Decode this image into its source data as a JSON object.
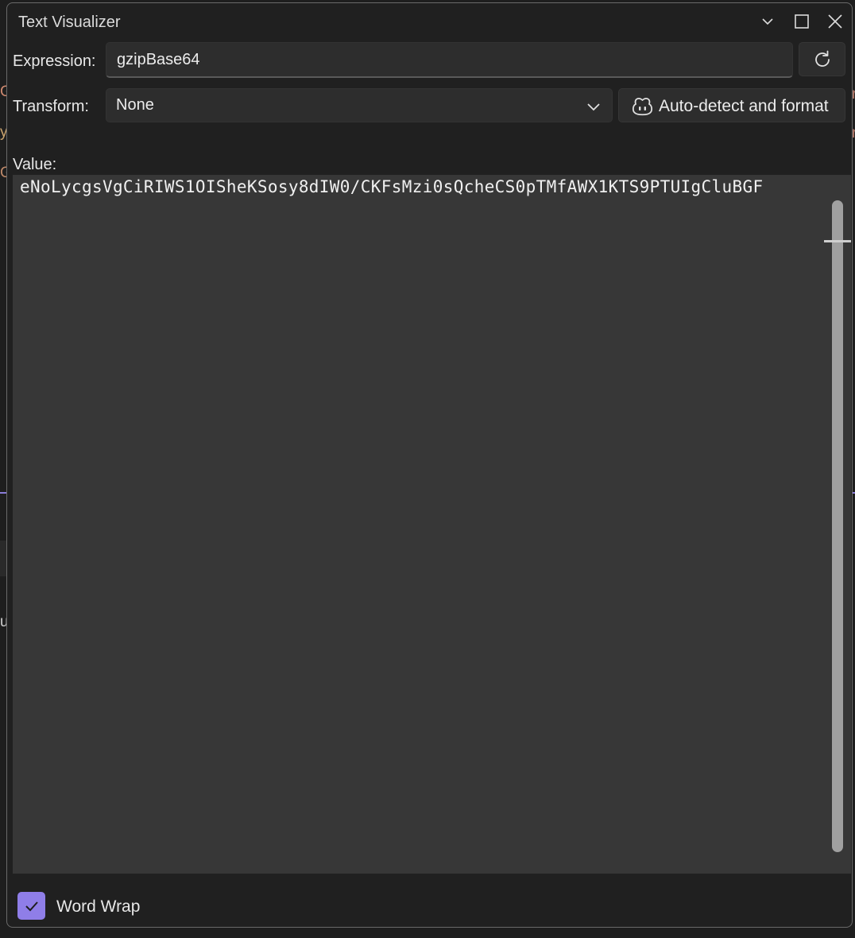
{
  "window": {
    "title": "Text Visualizer"
  },
  "titlebar_buttons": {
    "collapse_icon": "chevron-down-icon",
    "maximize_icon": "maximize-icon",
    "close_icon": "close-icon"
  },
  "expression": {
    "label": "Expression:",
    "value": "gzipBase64",
    "refresh_icon": "refresh-icon"
  },
  "transform": {
    "label": "Transform:",
    "selected": "None",
    "auto_button_label": "Auto-detect and format",
    "auto_button_icon": "copilot-icon"
  },
  "value": {
    "label": "Value:",
    "text": "eNoLycgsVgCiRIWS1OISheKSosy8dIW0/CKFsMzi0sQcheCS0pTMfAWX1KTS9PTUIgCluBGF"
  },
  "word_wrap": {
    "label": "Word Wrap",
    "checked": true
  },
  "colors": {
    "accent": "#8f7ee8",
    "window_bg": "#202020",
    "field_bg": "#2d2d2d",
    "value_bg": "#373737"
  }
}
